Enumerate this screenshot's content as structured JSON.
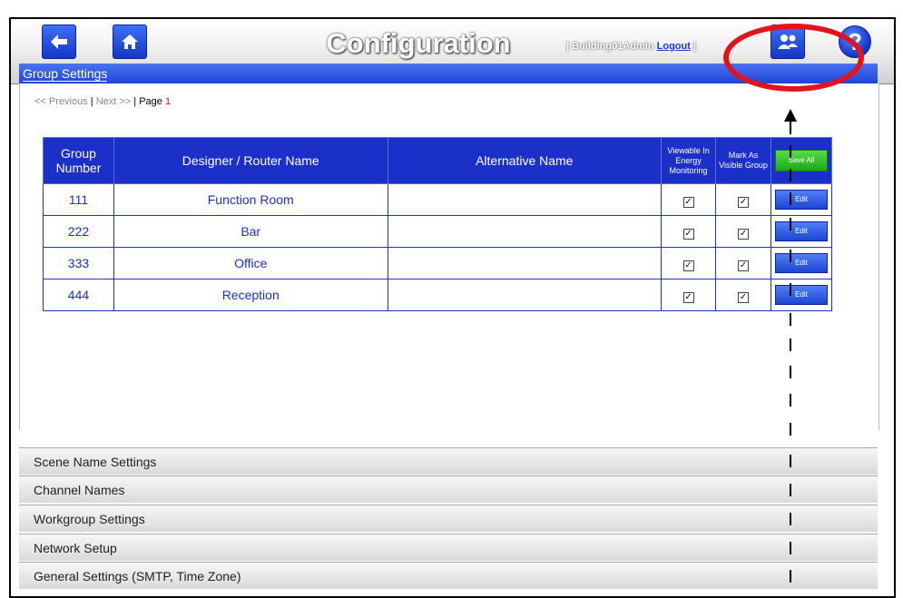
{
  "header": {
    "title": "Configuration",
    "user_label": "| Building01Admin",
    "logout_label": "Logout",
    "user_sep": "|",
    "help_label": "?"
  },
  "section": {
    "title": "Group Settings"
  },
  "pager": {
    "prev": "<< Previous",
    "next": "Next >>",
    "page_label": "Page",
    "page_number": "1",
    "sep": "|"
  },
  "table": {
    "headers": {
      "group_number": "Group Number",
      "designer_name": "Designer / Router Name",
      "alternative_name": "Alternative Name",
      "viewable": "Viewable In Energy Monitoring",
      "mark_visible": "Mark As Visible Group",
      "save_all": "Save All"
    },
    "rows": [
      {
        "number": "111",
        "name": "Function Room",
        "alt": "",
        "viewable": true,
        "visible": true,
        "edit": "Edit"
      },
      {
        "number": "222",
        "name": "Bar",
        "alt": "",
        "viewable": true,
        "visible": true,
        "edit": "Edit"
      },
      {
        "number": "333",
        "name": "Office",
        "alt": "",
        "viewable": true,
        "visible": true,
        "edit": "Edit"
      },
      {
        "number": "444",
        "name": "Reception",
        "alt": "",
        "viewable": true,
        "visible": true,
        "edit": "Edit"
      }
    ]
  },
  "accordion": [
    "Scene Name Settings",
    "Channel Names",
    "Workgroup Settings",
    "Network Setup",
    "General Settings (SMTP, Time Zone)"
  ],
  "colors": {
    "accent": "#1b2fc9",
    "highlight": "#e3121b",
    "save": "#1aa91a"
  },
  "icons": {
    "back": "arrow-left-icon",
    "home": "home-icon",
    "users": "users-icon",
    "help": "help-icon"
  }
}
